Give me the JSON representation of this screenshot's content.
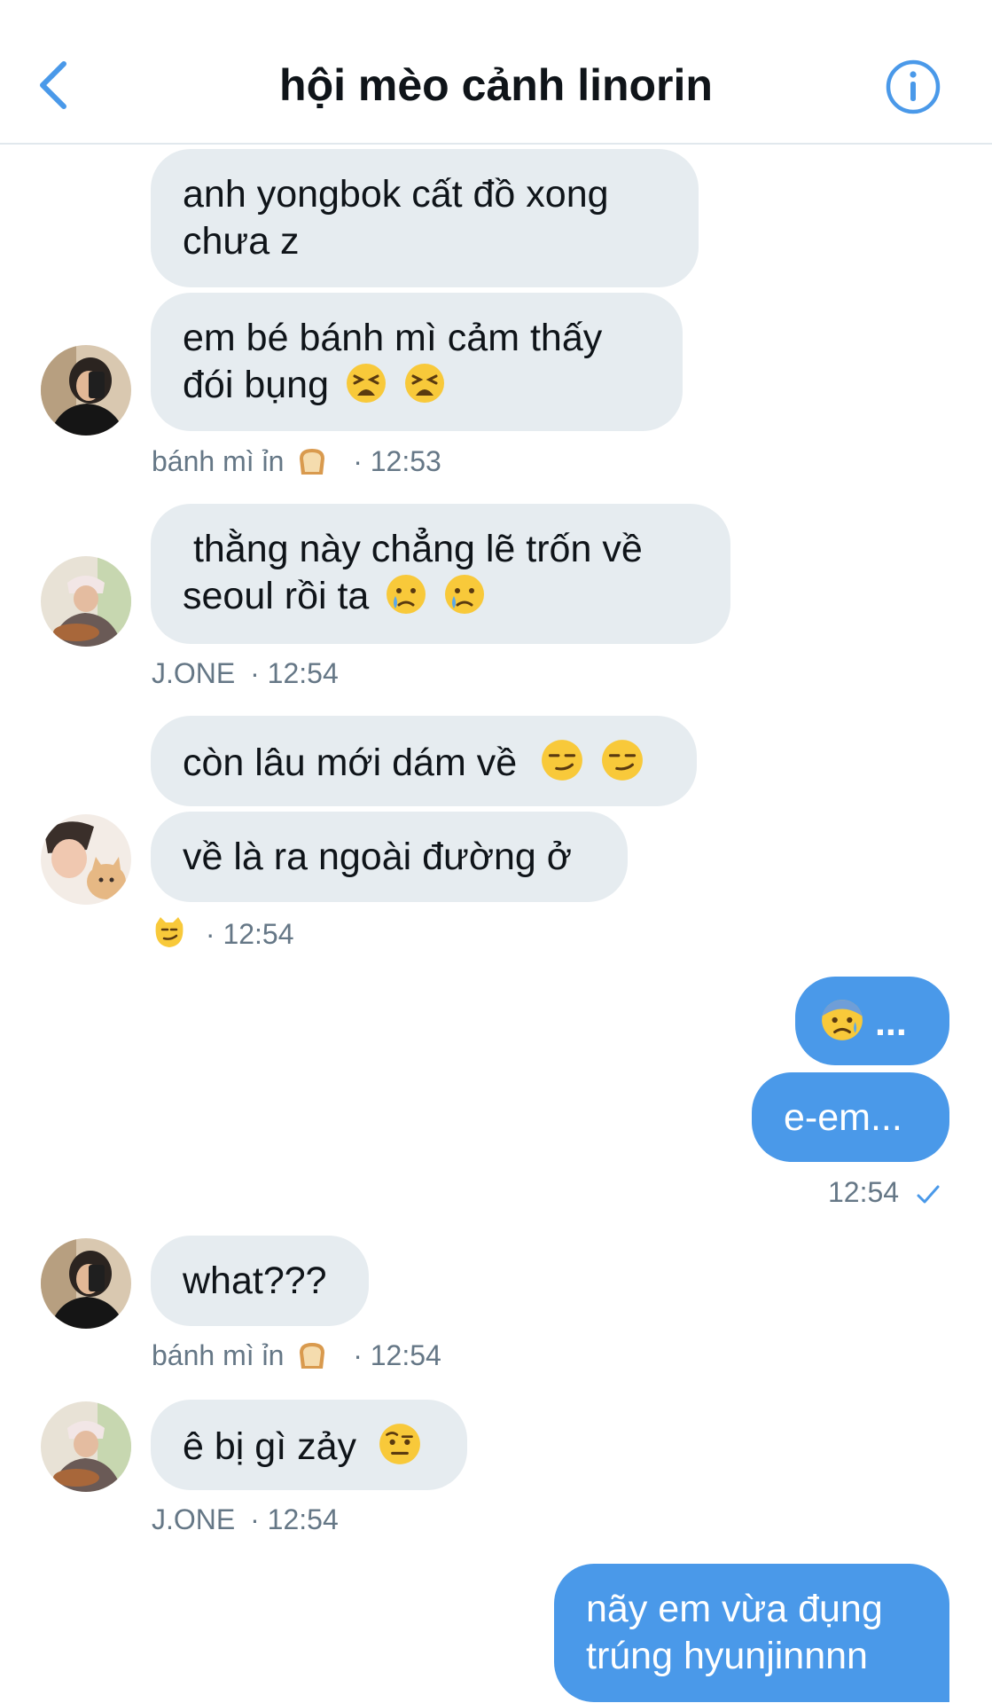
{
  "header": {
    "title": "hội mèo cảnh linorin",
    "back_icon": "chevron-left-icon",
    "info_icon": "info-icon",
    "accent_color": "#4a99e9"
  },
  "messages": [
    {
      "direction": "in",
      "sender": "bánh mì ỉn",
      "text": "anh yongbok cất đồ xong",
      "text2": "chưa z"
    },
    {
      "direction": "in",
      "sender": "bánh mì ỉn",
      "text": "em bé bánh mì cảm thấy",
      "text2": "đói bụng"
    },
    {
      "direction": "in",
      "sender": "J.ONE",
      "text": " thằng này chẳng lẽ trốn về",
      "text2": "seoul rồi ta"
    },
    {
      "direction": "in",
      "sender": "cat",
      "text": "còn lâu mới dám về"
    },
    {
      "direction": "in",
      "sender": "cat",
      "text": "về là ra ngoài đường ở"
    },
    {
      "direction": "out",
      "text": "..."
    },
    {
      "direction": "out",
      "text": "e-em..."
    },
    {
      "direction": "in",
      "sender": "bánh mì ỉn",
      "text": "what???"
    },
    {
      "direction": "in",
      "sender": "J.ONE",
      "text": "ê bị gì zảy"
    },
    {
      "direction": "out",
      "text": "nãy em vừa đụng",
      "text2": "trúng hyunjinnnn"
    }
  ],
  "meta": {
    "m1_name": "bánh mì ỉn",
    "m1_sep": "· 12:53",
    "m2_name": "J.ONE",
    "m2_sep": "· 12:54",
    "m3_sep": "· 12:54",
    "m4_time": "12:54",
    "m5_name": "bánh mì ỉn",
    "m5_sep": "· 12:54",
    "m6_name": "J.ONE",
    "m6_sep": "· 12:54"
  },
  "colors": {
    "incoming_bubble": "#e6ecf0",
    "outgoing_bubble": "#4a99e9",
    "meta_text": "#657786"
  }
}
